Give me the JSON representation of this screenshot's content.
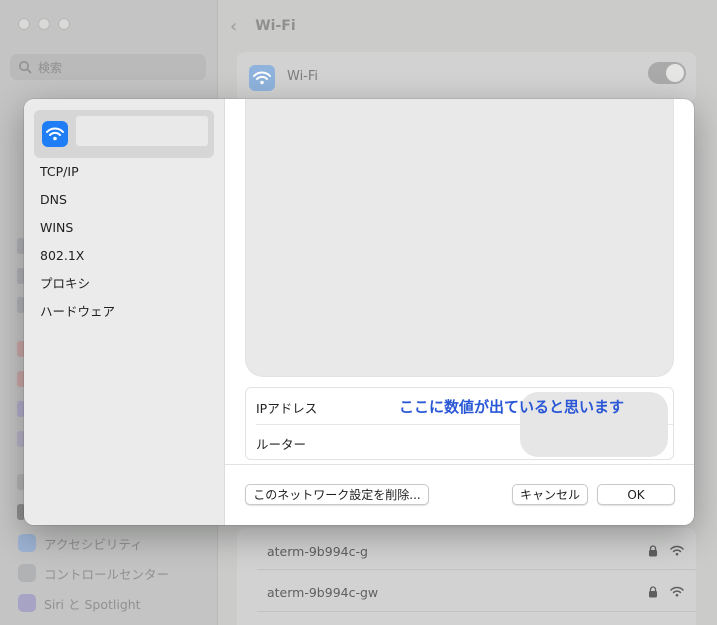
{
  "background": {
    "search_placeholder": "検索",
    "header_title": "Wi-Fi",
    "wifi_card_label": "Wi-Fi",
    "sidebar_items": [
      {
        "label": "アクセシビリティ",
        "icon": "accessibility-icon"
      },
      {
        "label": "コントロールセンター",
        "icon": "control-center-icon"
      },
      {
        "label": "Siri と Spotlight",
        "icon": "siri-icon"
      }
    ],
    "networks": [
      {
        "name": "aterm-9b994c-g"
      },
      {
        "name": "aterm-9b994c-gw"
      }
    ]
  },
  "sheet": {
    "network_name": "",
    "sidebar_items": [
      {
        "label": "TCP/IP"
      },
      {
        "label": "DNS"
      },
      {
        "label": "WINS"
      },
      {
        "label": "802.1X"
      },
      {
        "label": "プロキシ"
      },
      {
        "label": "ハードウェア"
      }
    ],
    "info_rows": [
      {
        "label": "IPアドレス"
      },
      {
        "label": "ルーター"
      }
    ],
    "annotation": "ここに数値が出ていると思います",
    "buttons": {
      "forget": "このネットワーク設定を削除...",
      "cancel": "キャンセル",
      "ok": "OK"
    }
  },
  "colors": {
    "accent": "#1f7ef5",
    "annotation": "#2a57d6"
  }
}
